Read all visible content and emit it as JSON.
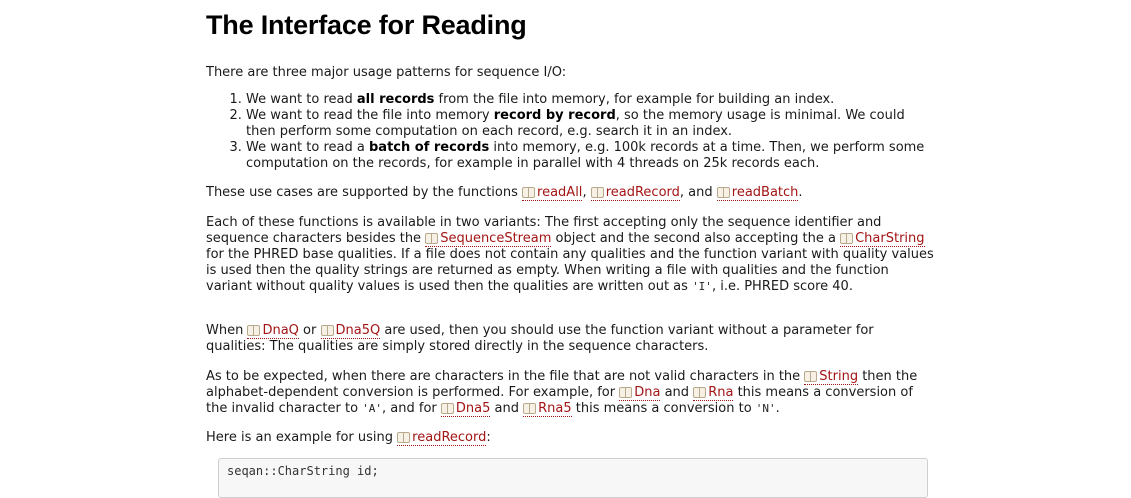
{
  "heading": "The Interface for Reading",
  "intro": "There are three major usage patterns for sequence I/O:",
  "list": {
    "item1": {
      "before": "We want to read ",
      "bold": "all records",
      "after": " from the file into memory, for example for building an index."
    },
    "item2": {
      "before": "We want to read the file into memory ",
      "bold": "record by record",
      "after": ", so the memory usage is minimal. We could then perform some computation on each record, e.g. search it in an index."
    },
    "item3": {
      "before": "We want to read a ",
      "bold": "batch of records",
      "after": " into memory, e.g. 100k records at a time. Then, we perform some computation on the records, for example in parallel with 4 threads on 25k records each."
    }
  },
  "p_usecases": {
    "before": "These use cases are supported by the functions ",
    "sep1": ", ",
    "sep2": ", and ",
    "end": "."
  },
  "p_variants": {
    "t1": "Each of these functions is available in two variants: The first accepting only the sequence identifier and sequence characters besides the ",
    "t2": " object and the second also accepting the a ",
    "t3": " for the PHRED base qualities. If a file does not contain any qualities and the function variant with quality values is used then the quality strings are returned as empty. When writing a file with qualities and the function variant without quality values is used then the qualities are written out as ",
    "code_I": "'I'",
    "t4": ", i.e. PHRED score 40."
  },
  "p_dnaq": {
    "t1": "When ",
    "t2": " or ",
    "t3": " are used, then you should use the function variant without a parameter for qualities: The qualities are simply stored directly in the sequence characters."
  },
  "p_conversion": {
    "t1": "As to be expected, when there are characters in the file that are not valid characters in the ",
    "t2": " then the alphabet-dependent conversion is performed. For example, for ",
    "t3": " and ",
    "t4": " this means a conversion of the invalid character to ",
    "code_A": "'A'",
    "t5": ", and for ",
    "t6": " and ",
    "t7": " this means a conversion to ",
    "code_N": "'N'",
    "t8": "."
  },
  "p_example": {
    "t1": "Here is an example for using ",
    "t2": ":"
  },
  "refs": {
    "readAll": "readAll",
    "readRecord": "readRecord",
    "readBatch": "readBatch",
    "SequenceStream": "SequenceStream",
    "CharString": "CharString",
    "DnaQ": "DnaQ",
    "Dna5Q": "Dna5Q",
    "String": "String",
    "Dna": "Dna",
    "Rna": "Rna",
    "Dna5": "Dna5",
    "Rna5": "Rna5",
    "readRecord2": "readRecord"
  },
  "code_block": {
    "line1": "seqan::CharString id;"
  },
  "colors": {
    "link": "#a31515",
    "text": "#1a1a1a"
  }
}
